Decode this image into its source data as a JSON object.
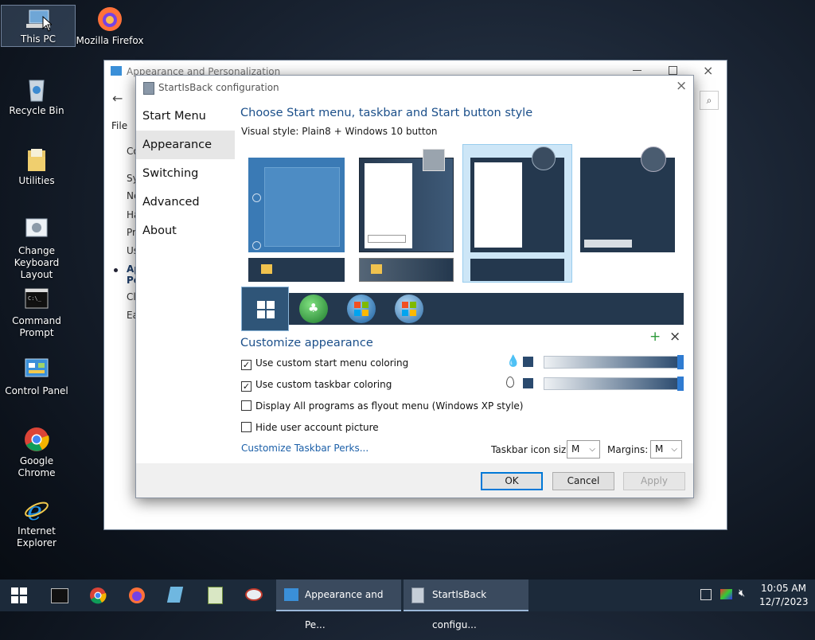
{
  "desktop": {
    "icons": [
      {
        "label": "This PC"
      },
      {
        "label": "Mozilla Firefox"
      },
      {
        "label": "Recycle Bin"
      },
      {
        "label": "Utilities"
      },
      {
        "label": "Change Keyboard Layout"
      },
      {
        "label": "Command Prompt"
      },
      {
        "label": "Control Panel"
      },
      {
        "label": "Google Chrome"
      },
      {
        "label": "Internet Explorer"
      }
    ]
  },
  "background_window": {
    "title": "Appearance and Personalization",
    "menu_file": "File",
    "sidebar_fragments": [
      "Co",
      "Sy",
      "Ne",
      "Ha",
      "Pr",
      "Us",
      "Ap",
      "Pe",
      "Cl",
      "Ea"
    ]
  },
  "dialog": {
    "title": "StartIsBack configuration",
    "nav": [
      "Start Menu",
      "Appearance",
      "Switching",
      "Advanced",
      "About"
    ],
    "active_nav": "Appearance",
    "heading": "Choose Start menu, taskbar and Start button style",
    "visual_style_label": "Visual style:",
    "visual_style_value": "Plain8 + Windows 10 button",
    "customize_heading": "Customize appearance",
    "options": [
      {
        "label": "Use custom start menu coloring",
        "checked": true
      },
      {
        "label": "Use custom taskbar coloring",
        "checked": true
      },
      {
        "label": "Display All programs as flyout menu (Windows XP style)",
        "checked": false
      },
      {
        "label": "Hide user account picture",
        "checked": false
      }
    ],
    "perks_link": "Customize Taskbar Perks...",
    "taskbar_icon_size_label": "Taskbar icon size:",
    "taskbar_icon_size_value": "M",
    "margins_label": "Margins:",
    "margins_value": "M",
    "buttons": {
      "ok": "OK",
      "cancel": "Cancel",
      "apply": "Apply"
    },
    "colors": {
      "swatch": "#2a4a6e",
      "slider_knob": "#2f7bd1",
      "link": "#1b5fa8"
    }
  },
  "taskbar": {
    "tasks": [
      {
        "label": "Appearance and Pe..."
      },
      {
        "label": "StartIsBack configu..."
      }
    ],
    "clock_time": "10:05 AM",
    "clock_date": "12/7/2023"
  }
}
